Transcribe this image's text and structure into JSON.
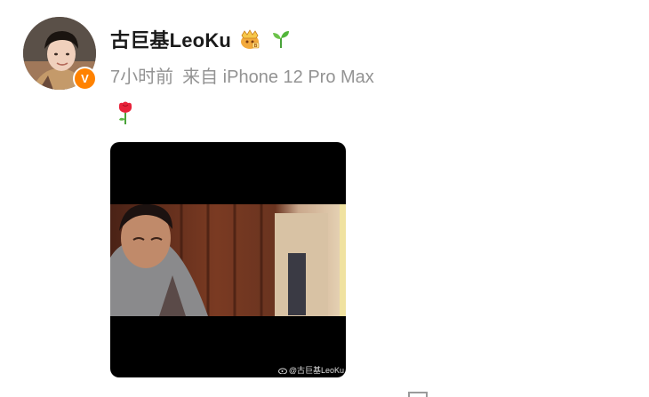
{
  "author": {
    "name": "古巨基LeoKu",
    "badge_icon": "gold-badge-icon",
    "level_icon": "sprout-icon",
    "verified_icon": "verified-v-icon",
    "verified_text": "V",
    "verified_color": "#ff8200"
  },
  "meta": {
    "time": "7小时前",
    "source": "来自 iPhone 12 Pro Max"
  },
  "post": {
    "content_emoji": "rose-icon",
    "media": {
      "type": "video-thumbnail",
      "watermark": "@古巨基LeoKu"
    }
  }
}
